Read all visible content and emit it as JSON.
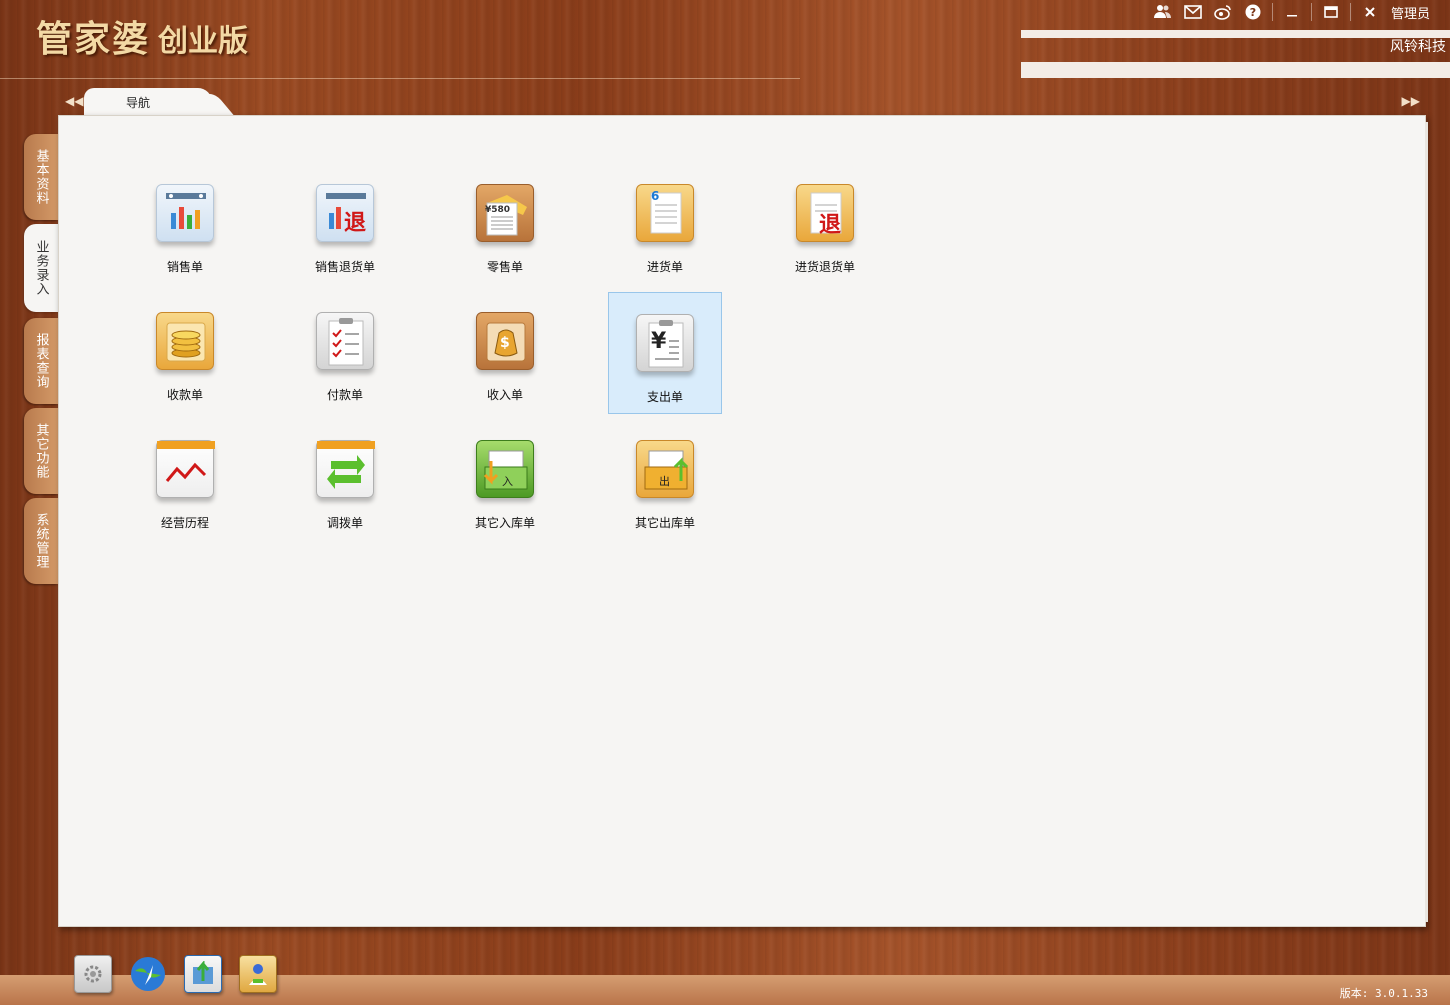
{
  "app": {
    "title": "管家婆",
    "edition": "创业版"
  },
  "topbar": {
    "user": "管理员",
    "company": "风铃科技"
  },
  "tabs": [
    {
      "label": "导航"
    }
  ],
  "sidebar": [
    {
      "label": "基本资料",
      "active": false
    },
    {
      "label": "业务录入",
      "active": true
    },
    {
      "label": "报表查询",
      "active": false
    },
    {
      "label": "其它功能",
      "active": false
    },
    {
      "label": "系统管理",
      "active": false
    }
  ],
  "items": [
    {
      "label": "销售单",
      "icon": "sales-order-icon"
    },
    {
      "label": "销售退货单",
      "icon": "sales-return-icon",
      "badge": "退"
    },
    {
      "label": "零售单",
      "icon": "retail-order-icon",
      "badge": "¥580"
    },
    {
      "label": "进货单",
      "icon": "purchase-order-icon",
      "badge": "6"
    },
    {
      "label": "进货退货单",
      "icon": "purchase-return-icon",
      "badge": "退"
    },
    {
      "label": "收款单",
      "icon": "receipt-icon"
    },
    {
      "label": "付款单",
      "icon": "payment-icon"
    },
    {
      "label": "收入单",
      "icon": "income-icon",
      "badge": "$"
    },
    {
      "label": "支出单",
      "icon": "expense-icon",
      "badge": "¥",
      "selected": true
    },
    {
      "label": "经营历程",
      "icon": "business-history-icon"
    },
    {
      "label": "调拨单",
      "icon": "transfer-icon"
    },
    {
      "label": "其它入库单",
      "icon": "other-inbound-icon",
      "badge": "入"
    },
    {
      "label": "其它出库单",
      "icon": "other-outbound-icon",
      "badge": "出"
    }
  ],
  "footer": {
    "version": "版本: 3.0.1.33"
  },
  "colors": {
    "wood": "#8a3d1a",
    "panel": "#f6f5f3",
    "selection": "#d9ecfb"
  }
}
